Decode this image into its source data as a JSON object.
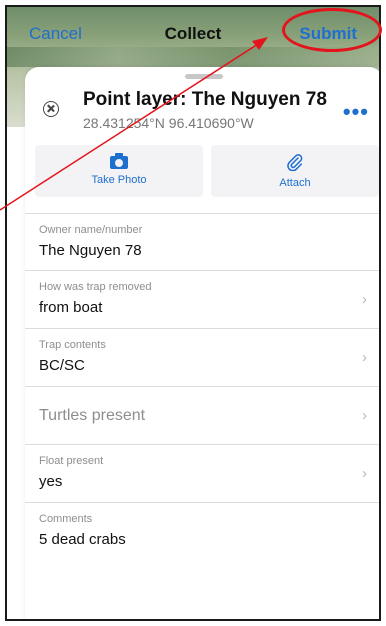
{
  "nav": {
    "cancel": "Cancel",
    "title": "Collect",
    "submit": "Submit"
  },
  "header": {
    "layer_title": "Point layer: The Nguyen 78",
    "coords": "28.431254°N 96.410690°W",
    "more": "•••"
  },
  "actions": {
    "take_photo": "Take Photo",
    "attach": "Attach"
  },
  "fields": {
    "owner_label": "Owner name/number",
    "owner_value": "The Nguyen 78",
    "trap_removed_label": "How was trap removed",
    "trap_removed_value": "from boat",
    "trap_contents_label": "Trap contents",
    "trap_contents_value": "BC/SC",
    "turtles_placeholder": "Turtles present",
    "float_label": "Float present",
    "float_value": "yes",
    "comments_label": "Comments",
    "comments_value": "5 dead crabs"
  },
  "icons": {
    "chevron": "›",
    "paperclip": "⌇"
  },
  "colors": {
    "accent": "#1f6fcf",
    "annotation": "#e3141b"
  }
}
